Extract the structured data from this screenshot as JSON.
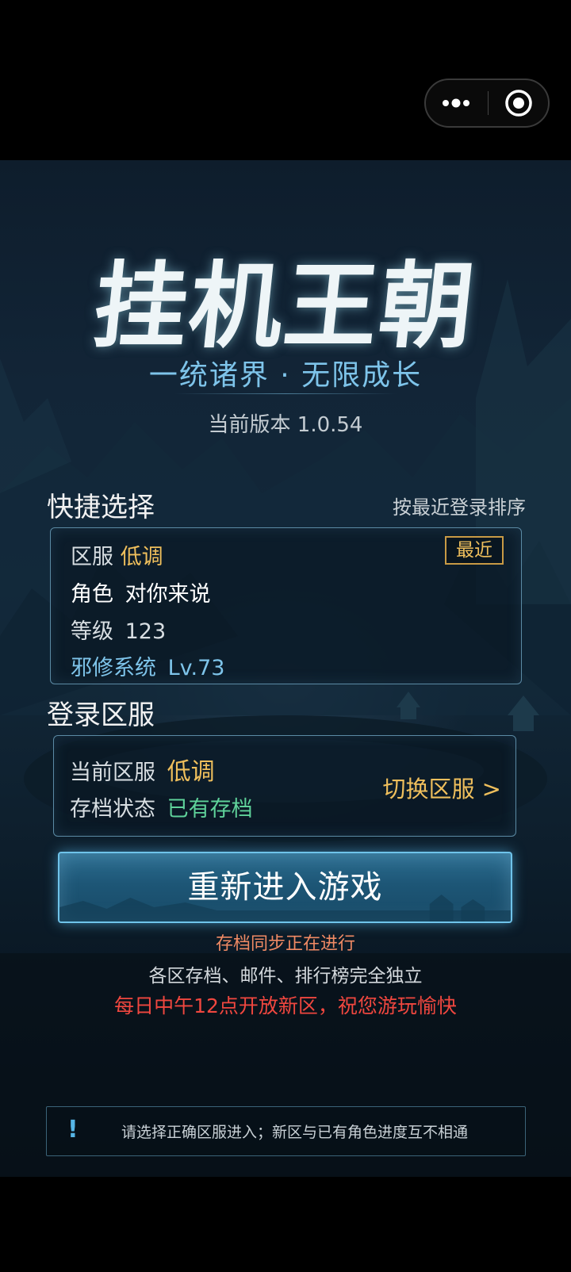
{
  "capsule": {
    "more_icon": "more-dots-icon",
    "close_icon": "target-circle-icon"
  },
  "game": {
    "title": "挂机王朝",
    "slogan": "一统诸界 · 无限成长",
    "version": "当前版本 1.0.54"
  },
  "quick_select": {
    "title": "快捷选择",
    "sort_label": "按最近登录排序",
    "zone_label": "区服",
    "zone_value": "低调",
    "recent_badge": "最近",
    "role_label": "角色",
    "role_value": "对你来说",
    "level_label": "等级",
    "level_value": "123",
    "system_label": "邪修系统",
    "system_value": "Lv.73"
  },
  "login_zone": {
    "title": "登录区服",
    "current_label": "当前区服",
    "current_value": "低调",
    "save_label": "存档状态",
    "save_value": "已有存档",
    "switch_label": "切换区服 >"
  },
  "enter_button": {
    "label": "重新进入游戏"
  },
  "info": {
    "sync": "存档同步正在进行",
    "independent": "各区存档、邮件、排行榜完全独立",
    "new_zone": "每日中午12点开放新区，祝您游玩愉快"
  },
  "notice": {
    "icon": "!",
    "text": "请选择正确区服进入；新区与已有角色进度互不相通"
  },
  "colors": {
    "gold": "#efbf5c",
    "blue": "#7ec4ea",
    "green": "#5fd29a",
    "red": "#f0473f",
    "orange": "#f08a64"
  }
}
